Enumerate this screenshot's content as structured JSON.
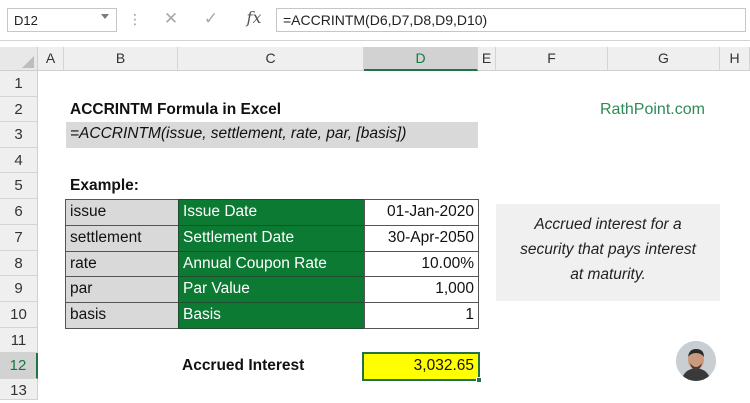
{
  "formula_bar": {
    "name_box": "D12",
    "fx_label": "fx",
    "formula": "=ACCRINTM(D6,D7,D8,D9,D10)",
    "cancel_symbol": "✕",
    "enter_symbol": "✓"
  },
  "columns": [
    "A",
    "B",
    "C",
    "D",
    "E",
    "F",
    "G",
    "H"
  ],
  "rows": [
    "1",
    "2",
    "3",
    "4",
    "5",
    "6",
    "7",
    "8",
    "9",
    "10",
    "11",
    "12",
    "13"
  ],
  "active_cell": {
    "column": "D",
    "row": "12"
  },
  "sheet": {
    "title": "ACCRINTM Formula in Excel",
    "syntax": "=ACCRINTM(issue, settlement, rate, par, [basis])",
    "brand": "RathPoint.com",
    "example_label": "Example:",
    "table": [
      {
        "arg": "issue",
        "label": "Issue Date",
        "value": "01-Jan-2020"
      },
      {
        "arg": "settlement",
        "label": "Settlement Date",
        "value": "30-Apr-2050"
      },
      {
        "arg": "rate",
        "label": "Annual Coupon Rate",
        "value": "10.00%"
      },
      {
        "arg": "par",
        "label": "Par Value",
        "value": "1,000"
      },
      {
        "arg": "basis",
        "label": "Basis",
        "value": "1"
      }
    ],
    "note_lines": [
      "Accrued interest for a",
      "security that pays interest",
      "at maturity."
    ],
    "result_label": "Accrued Interest",
    "result_value": "3,032.65"
  },
  "colors": {
    "accent_green": "#217346",
    "table_green": "#0d7a33",
    "brand_green": "#2e8b57",
    "grey_fill": "#d9d9d9",
    "result_fill": "#ffff00"
  },
  "icons": [
    "chevron-down-icon",
    "more-options-icon",
    "cancel-icon",
    "enter-icon",
    "function-icon",
    "avatar"
  ]
}
